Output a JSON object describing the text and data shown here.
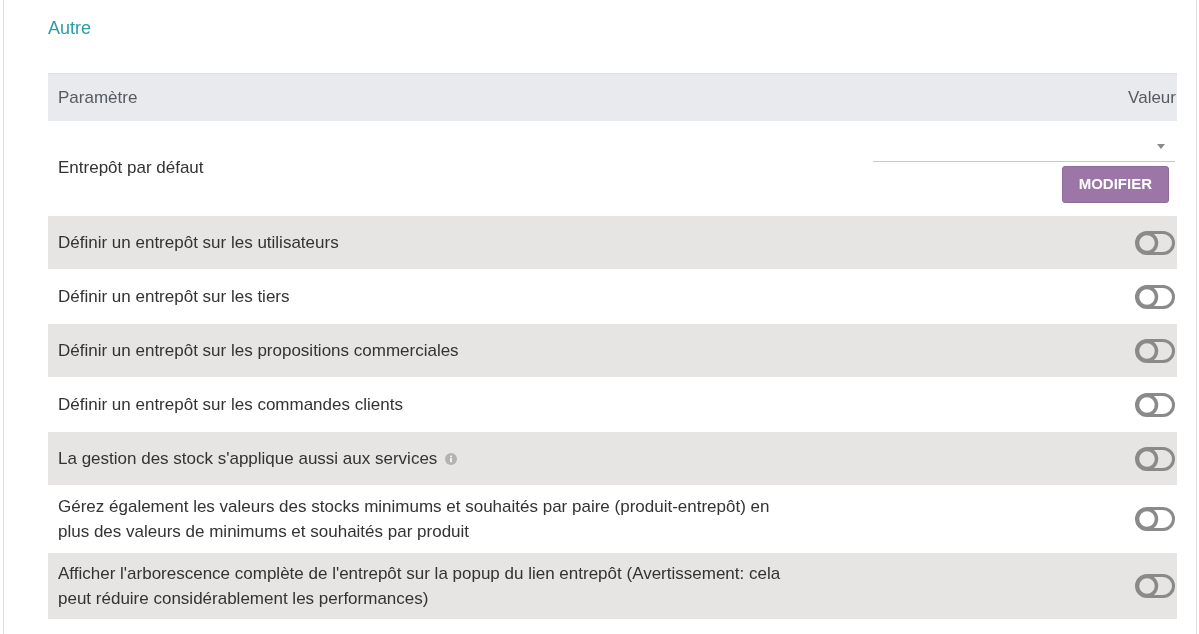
{
  "section_title": "Autre",
  "table": {
    "columns": [
      "Paramètre",
      "Valeur"
    ],
    "rows": [
      {
        "kind": "select",
        "label": "Entrepôt par défaut",
        "button": "MODIFIER"
      },
      {
        "kind": "toggle",
        "label": "Définir un entrepôt sur les utilisateurs",
        "on": false
      },
      {
        "kind": "toggle",
        "label": "Définir un entrepôt sur les tiers",
        "on": false
      },
      {
        "kind": "toggle",
        "label": "Définir un entrepôt sur les propositions commerciales",
        "on": false
      },
      {
        "kind": "toggle",
        "label": "Définir un entrepôt sur les commandes clients",
        "on": false
      },
      {
        "kind": "toggle",
        "label": "La gestion des stock s'applique aussi aux services",
        "on": false,
        "info": true
      },
      {
        "kind": "toggle",
        "label": "Gérez également les valeurs des stocks minimums et souhaités par paire (produit-entrepôt) en plus des valeurs de minimums et souhaités par produit",
        "on": false
      },
      {
        "kind": "toggle",
        "label": "Afficher l'arborescence complète de l'entrepôt sur la popup du lien entrepôt (Avertissement: cela peut réduire considérablement les performances)",
        "on": false
      }
    ]
  }
}
